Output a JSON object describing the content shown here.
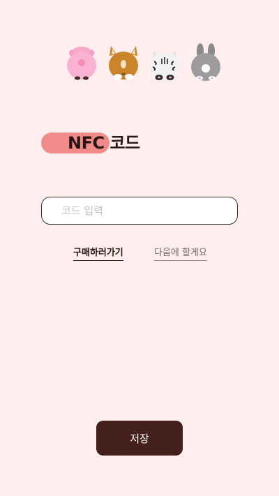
{
  "mascots": [
    {
      "name": "pig",
      "icon": "pig-back-icon"
    },
    {
      "name": "corgi",
      "icon": "corgi-back-icon"
    },
    {
      "name": "cat",
      "icon": "cat-back-icon"
    },
    {
      "name": "rabbit",
      "icon": "rabbit-back-icon"
    }
  ],
  "header": {
    "title_highlight": "NFC",
    "title_rest": " 코드"
  },
  "form": {
    "code_placeholder": "코드 입력",
    "code_value": ""
  },
  "links": {
    "buy_label": "구매하러가기",
    "later_label": "다음에 할게요"
  },
  "actions": {
    "save_label": "저장"
  },
  "colors": {
    "background": "#FEEFEE",
    "highlight_pill": "#F08B8A",
    "primary_dark": "#43201B",
    "text_dark": "#2B1512"
  }
}
